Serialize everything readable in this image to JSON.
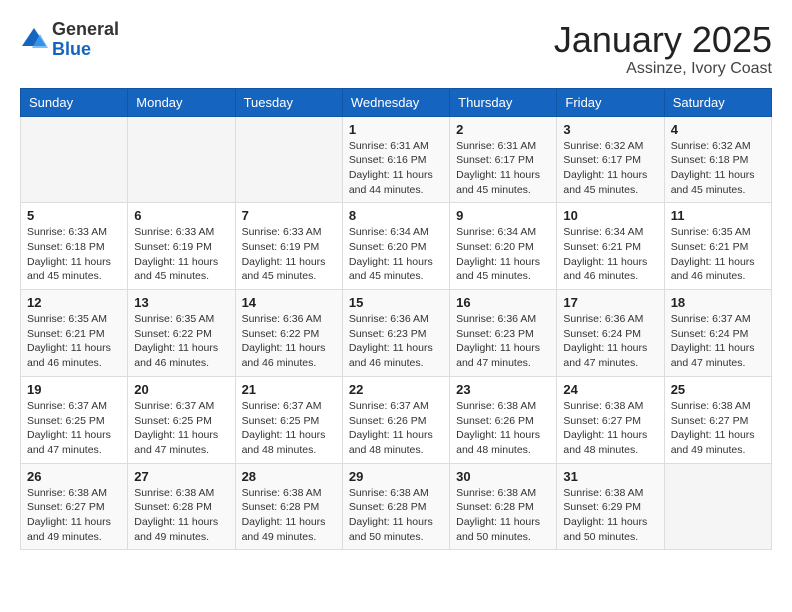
{
  "header": {
    "logo_general": "General",
    "logo_blue": "Blue",
    "month_title": "January 2025",
    "location": "Assinze, Ivory Coast"
  },
  "weekdays": [
    "Sunday",
    "Monday",
    "Tuesday",
    "Wednesday",
    "Thursday",
    "Friday",
    "Saturday"
  ],
  "weeks": [
    [
      {
        "day": "",
        "info": ""
      },
      {
        "day": "",
        "info": ""
      },
      {
        "day": "",
        "info": ""
      },
      {
        "day": "1",
        "info": "Sunrise: 6:31 AM\nSunset: 6:16 PM\nDaylight: 11 hours\nand 44 minutes."
      },
      {
        "day": "2",
        "info": "Sunrise: 6:31 AM\nSunset: 6:17 PM\nDaylight: 11 hours\nand 45 minutes."
      },
      {
        "day": "3",
        "info": "Sunrise: 6:32 AM\nSunset: 6:17 PM\nDaylight: 11 hours\nand 45 minutes."
      },
      {
        "day": "4",
        "info": "Sunrise: 6:32 AM\nSunset: 6:18 PM\nDaylight: 11 hours\nand 45 minutes."
      }
    ],
    [
      {
        "day": "5",
        "info": "Sunrise: 6:33 AM\nSunset: 6:18 PM\nDaylight: 11 hours\nand 45 minutes."
      },
      {
        "day": "6",
        "info": "Sunrise: 6:33 AM\nSunset: 6:19 PM\nDaylight: 11 hours\nand 45 minutes."
      },
      {
        "day": "7",
        "info": "Sunrise: 6:33 AM\nSunset: 6:19 PM\nDaylight: 11 hours\nand 45 minutes."
      },
      {
        "day": "8",
        "info": "Sunrise: 6:34 AM\nSunset: 6:20 PM\nDaylight: 11 hours\nand 45 minutes."
      },
      {
        "day": "9",
        "info": "Sunrise: 6:34 AM\nSunset: 6:20 PM\nDaylight: 11 hours\nand 45 minutes."
      },
      {
        "day": "10",
        "info": "Sunrise: 6:34 AM\nSunset: 6:21 PM\nDaylight: 11 hours\nand 46 minutes."
      },
      {
        "day": "11",
        "info": "Sunrise: 6:35 AM\nSunset: 6:21 PM\nDaylight: 11 hours\nand 46 minutes."
      }
    ],
    [
      {
        "day": "12",
        "info": "Sunrise: 6:35 AM\nSunset: 6:21 PM\nDaylight: 11 hours\nand 46 minutes."
      },
      {
        "day": "13",
        "info": "Sunrise: 6:35 AM\nSunset: 6:22 PM\nDaylight: 11 hours\nand 46 minutes."
      },
      {
        "day": "14",
        "info": "Sunrise: 6:36 AM\nSunset: 6:22 PM\nDaylight: 11 hours\nand 46 minutes."
      },
      {
        "day": "15",
        "info": "Sunrise: 6:36 AM\nSunset: 6:23 PM\nDaylight: 11 hours\nand 46 minutes."
      },
      {
        "day": "16",
        "info": "Sunrise: 6:36 AM\nSunset: 6:23 PM\nDaylight: 11 hours\nand 47 minutes."
      },
      {
        "day": "17",
        "info": "Sunrise: 6:36 AM\nSunset: 6:24 PM\nDaylight: 11 hours\nand 47 minutes."
      },
      {
        "day": "18",
        "info": "Sunrise: 6:37 AM\nSunset: 6:24 PM\nDaylight: 11 hours\nand 47 minutes."
      }
    ],
    [
      {
        "day": "19",
        "info": "Sunrise: 6:37 AM\nSunset: 6:25 PM\nDaylight: 11 hours\nand 47 minutes."
      },
      {
        "day": "20",
        "info": "Sunrise: 6:37 AM\nSunset: 6:25 PM\nDaylight: 11 hours\nand 47 minutes."
      },
      {
        "day": "21",
        "info": "Sunrise: 6:37 AM\nSunset: 6:25 PM\nDaylight: 11 hours\nand 48 minutes."
      },
      {
        "day": "22",
        "info": "Sunrise: 6:37 AM\nSunset: 6:26 PM\nDaylight: 11 hours\nand 48 minutes."
      },
      {
        "day": "23",
        "info": "Sunrise: 6:38 AM\nSunset: 6:26 PM\nDaylight: 11 hours\nand 48 minutes."
      },
      {
        "day": "24",
        "info": "Sunrise: 6:38 AM\nSunset: 6:27 PM\nDaylight: 11 hours\nand 48 minutes."
      },
      {
        "day": "25",
        "info": "Sunrise: 6:38 AM\nSunset: 6:27 PM\nDaylight: 11 hours\nand 49 minutes."
      }
    ],
    [
      {
        "day": "26",
        "info": "Sunrise: 6:38 AM\nSunset: 6:27 PM\nDaylight: 11 hours\nand 49 minutes."
      },
      {
        "day": "27",
        "info": "Sunrise: 6:38 AM\nSunset: 6:28 PM\nDaylight: 11 hours\nand 49 minutes."
      },
      {
        "day": "28",
        "info": "Sunrise: 6:38 AM\nSunset: 6:28 PM\nDaylight: 11 hours\nand 49 minutes."
      },
      {
        "day": "29",
        "info": "Sunrise: 6:38 AM\nSunset: 6:28 PM\nDaylight: 11 hours\nand 50 minutes."
      },
      {
        "day": "30",
        "info": "Sunrise: 6:38 AM\nSunset: 6:28 PM\nDaylight: 11 hours\nand 50 minutes."
      },
      {
        "day": "31",
        "info": "Sunrise: 6:38 AM\nSunset: 6:29 PM\nDaylight: 11 hours\nand 50 minutes."
      },
      {
        "day": "",
        "info": ""
      }
    ]
  ]
}
